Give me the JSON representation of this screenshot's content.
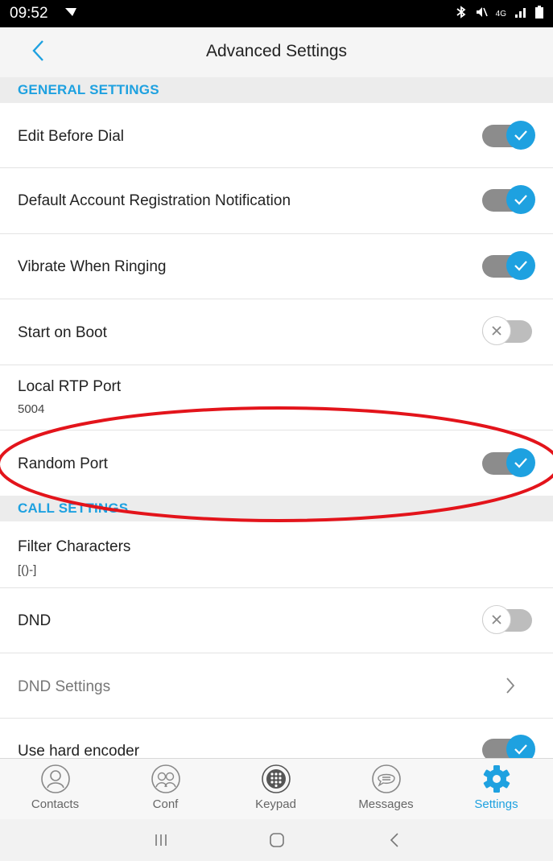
{
  "status_bar": {
    "time": "09:52",
    "right_text": "4G"
  },
  "header": {
    "title": "Advanced Settings"
  },
  "sections": {
    "general": "GENERAL SETTINGS",
    "call": "CALL SETTINGS"
  },
  "rows": {
    "edit_before_dial": {
      "label": "Edit Before Dial",
      "checked": true
    },
    "default_account_notification": {
      "label": "Default Account Registration Notification",
      "checked": true
    },
    "vibrate": {
      "label": "Vibrate When Ringing",
      "checked": true
    },
    "start_on_boot": {
      "label": "Start on Boot",
      "checked": false
    },
    "local_rtp_port": {
      "label": "Local RTP Port",
      "value": "5004"
    },
    "random_port": {
      "label": "Random Port",
      "checked": true
    },
    "filter_characters": {
      "label": "Filter Characters",
      "value": "[()-]"
    },
    "dnd": {
      "label": "DND",
      "checked": false
    },
    "dnd_settings": {
      "label": "DND Settings"
    },
    "hard_encoder": {
      "label": "Use hard encoder",
      "checked": true
    }
  },
  "tabs": [
    {
      "label": "Contacts",
      "icon": "contacts-icon"
    },
    {
      "label": "Conf",
      "icon": "conference-icon"
    },
    {
      "label": "Keypad",
      "icon": "keypad-icon"
    },
    {
      "label": "Messages",
      "icon": "messages-icon"
    },
    {
      "label": "Settings",
      "icon": "settings-gear-icon",
      "active": true
    }
  ],
  "colors": {
    "accent": "#1ea1e0",
    "annotation": "#e3141b",
    "toggle_track_on": "#8c8c8c",
    "toggle_track_off": "#bdbdbd"
  }
}
